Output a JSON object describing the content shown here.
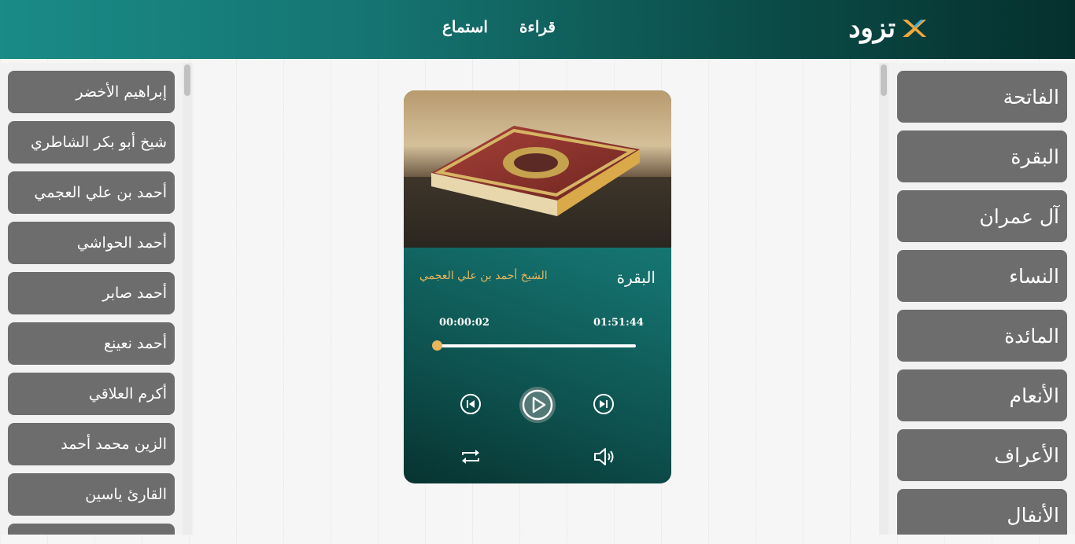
{
  "header": {
    "logo_text": "تزود",
    "nav": [
      {
        "label": "قراءة"
      },
      {
        "label": "استماع"
      }
    ]
  },
  "reciters": [
    {
      "label": "إبراهيم الأخضر"
    },
    {
      "label": "شيخ أبو بكر الشاطري"
    },
    {
      "label": "أحمد بن علي العجمي"
    },
    {
      "label": "أحمد الحواشي"
    },
    {
      "label": "أحمد صابر"
    },
    {
      "label": "أحمد نعينع"
    },
    {
      "label": "أكرم العلاقي"
    },
    {
      "label": "الزين محمد أحمد"
    },
    {
      "label": "القارئ ياسين"
    },
    {
      "label": ""
    }
  ],
  "surahs": [
    {
      "label": "الفاتحة"
    },
    {
      "label": "البقرة"
    },
    {
      "label": "آل عمران"
    },
    {
      "label": "النساء"
    },
    {
      "label": "المائدة"
    },
    {
      "label": "الأنعام"
    },
    {
      "label": "الأعراف"
    },
    {
      "label": "الأنفال"
    }
  ],
  "player": {
    "surah_title": "البقرة",
    "reciter_name": "الشيخ أحمد بن علي العجمي",
    "current_time": "00:00:02",
    "duration": "01:51:44",
    "progress_fraction": 0.0003,
    "icons": [
      "prev-icon",
      "play-icon",
      "next-icon",
      "repeat-icon",
      "volume-icon"
    ]
  },
  "colors": {
    "header_start": "#1a8b87",
    "header_end": "#05302d",
    "accent_gold": "#e7b65e",
    "button_gray": "#6d6d6d"
  }
}
